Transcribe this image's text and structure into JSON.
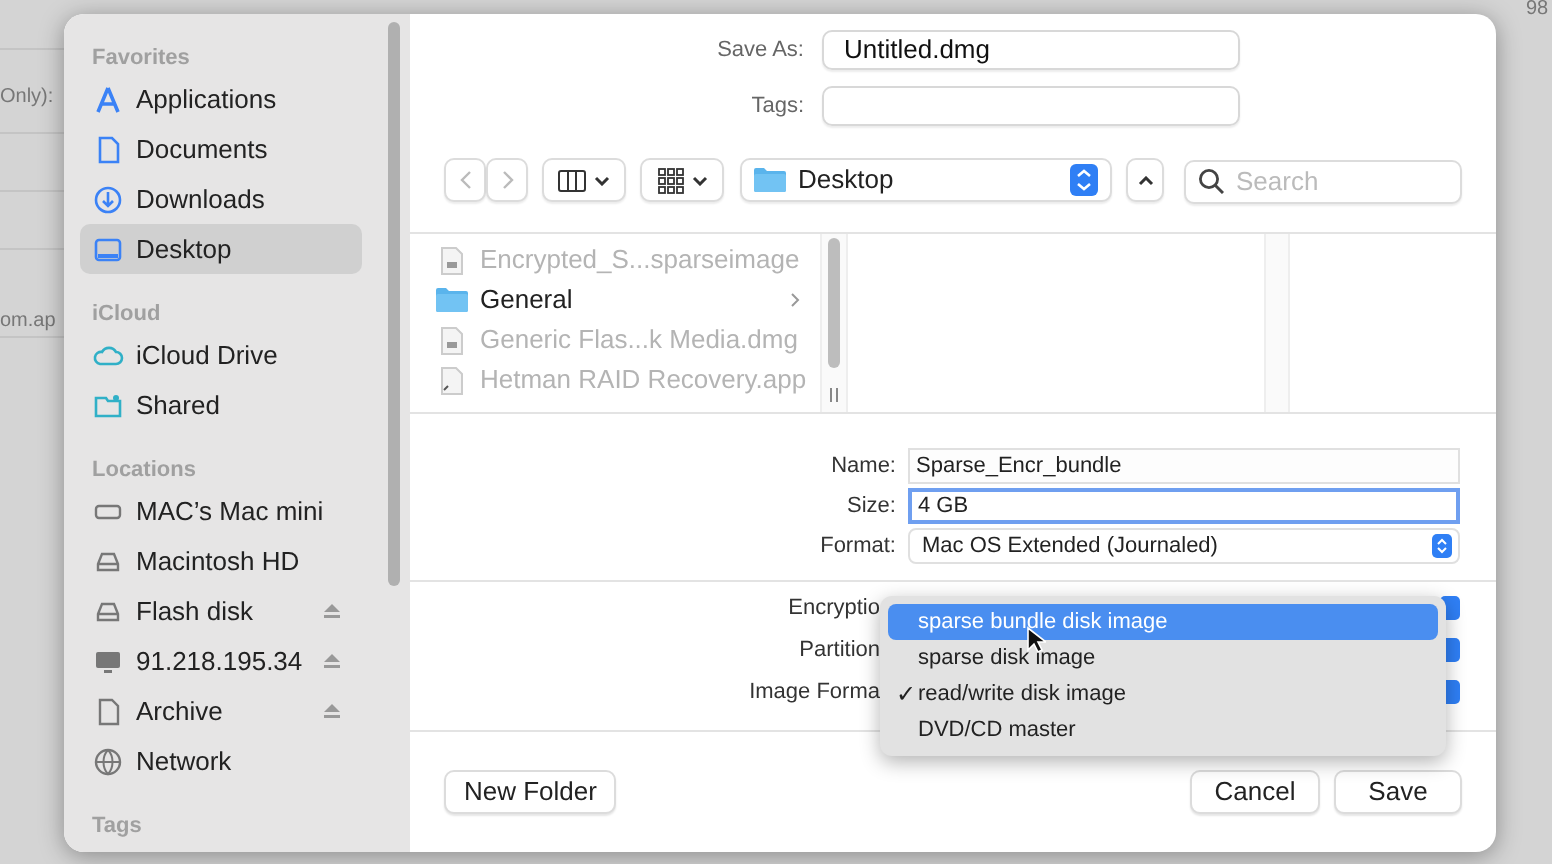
{
  "background": {
    "texts": [
      "Only):",
      "om.ap",
      "98"
    ]
  },
  "sidebar": {
    "sections": [
      {
        "title": "Favorites",
        "items": [
          {
            "label": "Applications",
            "selected": false,
            "ejectable": false
          },
          {
            "label": "Documents",
            "selected": false,
            "ejectable": false
          },
          {
            "label": "Downloads",
            "selected": false,
            "ejectable": false
          },
          {
            "label": "Desktop",
            "selected": true,
            "ejectable": false
          }
        ]
      },
      {
        "title": "iCloud",
        "items": [
          {
            "label": "iCloud Drive",
            "selected": false,
            "ejectable": false
          },
          {
            "label": "Shared",
            "selected": false,
            "ejectable": false
          }
        ]
      },
      {
        "title": "Locations",
        "items": [
          {
            "label": "MAC’s Mac mini",
            "selected": false,
            "ejectable": false
          },
          {
            "label": "Macintosh HD",
            "selected": false,
            "ejectable": false
          },
          {
            "label": "Flash disk",
            "selected": false,
            "ejectable": true
          },
          {
            "label": "91.218.195.34",
            "selected": false,
            "ejectable": true
          },
          {
            "label": "Archive",
            "selected": false,
            "ejectable": true
          },
          {
            "label": "Network",
            "selected": false,
            "ejectable": false
          }
        ]
      },
      {
        "title": "Tags"
      }
    ]
  },
  "save_as": {
    "label": "Save As:",
    "value": "Untitled.dmg"
  },
  "tags": {
    "label": "Tags:"
  },
  "toolbar": {
    "location": "Desktop",
    "search_placeholder": "Search"
  },
  "files": [
    {
      "name": "Encrypted_S...sparseimage",
      "kind": "file",
      "dimmed": true,
      "has_children": false
    },
    {
      "name": "General",
      "kind": "folder",
      "dimmed": false,
      "has_children": true
    },
    {
      "name": "Generic Flas...k Media.dmg",
      "kind": "file",
      "dimmed": true,
      "has_children": false
    },
    {
      "name": "Hetman RAID Recovery.app",
      "kind": "app",
      "dimmed": true,
      "has_children": false
    }
  ],
  "form": [
    {
      "label": "Name:",
      "value": "Sparse_Encr_bundle",
      "kind": "text",
      "focused": false
    },
    {
      "label": "Size:",
      "value": "4 GB",
      "kind": "text",
      "focused": true
    },
    {
      "label": "Format:",
      "value": "Mac OS Extended (Journaled)",
      "kind": "popup"
    }
  ],
  "options": [
    {
      "label": "Encryptio"
    },
    {
      "label": "Partition"
    },
    {
      "label": "Image Forma"
    }
  ],
  "menu": [
    {
      "label": "sparse bundle disk image",
      "selected": true,
      "checked": false
    },
    {
      "label": "sparse disk image",
      "selected": false,
      "checked": false
    },
    {
      "label": "read/write disk image",
      "selected": false,
      "checked": true
    },
    {
      "label": "DVD/CD master",
      "selected": false,
      "checked": false
    }
  ],
  "buttons": {
    "left": "New Folder",
    "cancel": "Cancel",
    "save": "Save",
    "check_mark": "✓"
  }
}
